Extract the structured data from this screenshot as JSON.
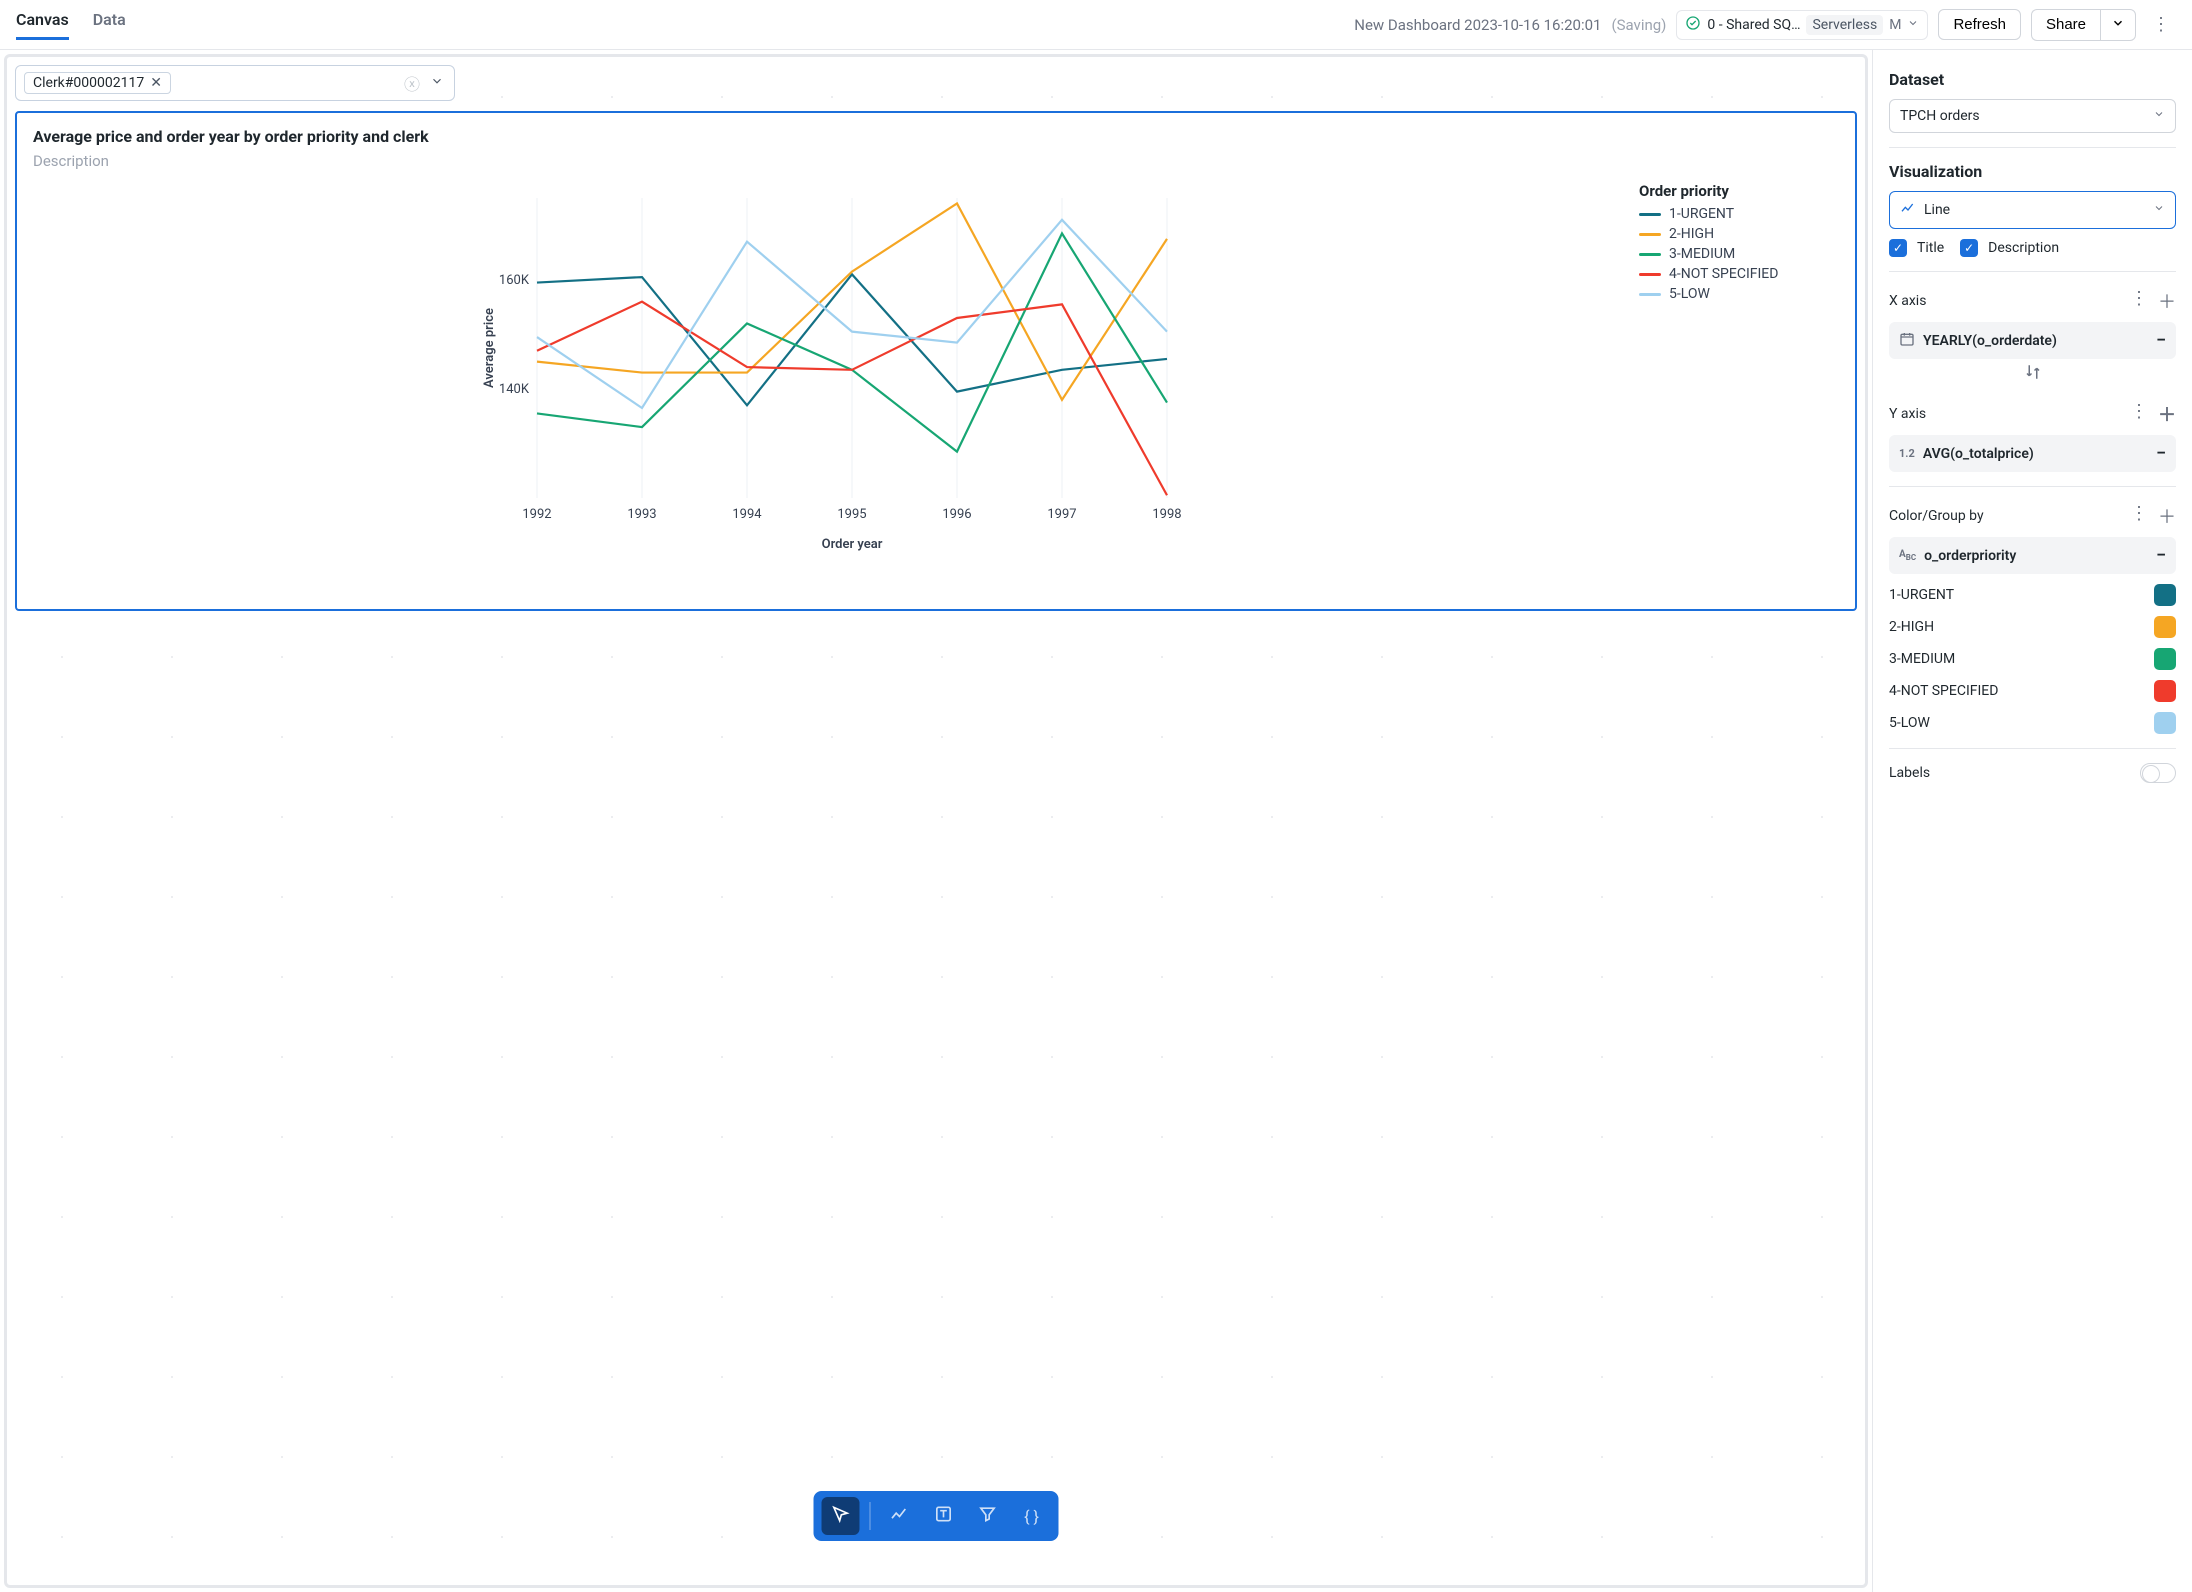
{
  "header": {
    "tabs": [
      {
        "label": "Canvas",
        "active": true
      },
      {
        "label": "Data",
        "active": false
      }
    ],
    "dashboard_title": "New Dashboard 2023-10-16 16:20:01",
    "saving_label": "(Saving)",
    "warehouse": {
      "name": "0 - Shared SQ…",
      "type": "Serverless",
      "size": "M"
    },
    "refresh_label": "Refresh",
    "share_label": "Share"
  },
  "filter": {
    "chip_text": "Clerk#000002117"
  },
  "chart": {
    "title": "Average price and order year by order priority and clerk",
    "description_placeholder": "Description",
    "legend_title": "Order priority",
    "x_axis_title": "Order year",
    "y_axis_title": "Average price"
  },
  "chart_data": {
    "type": "line",
    "x": [
      1992,
      1993,
      1994,
      1995,
      1996,
      1997,
      1998
    ],
    "xlabel": "Order year",
    "ylabel": "Average price",
    "ylim": [
      120000,
      175000
    ],
    "y_ticks": [
      140000,
      160000
    ],
    "y_tick_labels": [
      "140K",
      "160K"
    ],
    "series": [
      {
        "name": "1-URGENT",
        "color": "#137085",
        "values": [
          159500,
          160500,
          137000,
          161000,
          139500,
          143500,
          145500
        ]
      },
      {
        "name": "2-HIGH",
        "color": "#f5a623",
        "values": [
          145000,
          143000,
          143000,
          161500,
          174000,
          138000,
          167500
        ]
      },
      {
        "name": "3-MEDIUM",
        "color": "#17a673",
        "values": [
          135500,
          133000,
          152000,
          143500,
          128500,
          168500,
          137500
        ]
      },
      {
        "name": "4-NOT SPECIFIED",
        "color": "#ef3b2c",
        "values": [
          147000,
          156000,
          144000,
          143500,
          153000,
          155500,
          120500
        ]
      },
      {
        "name": "5-LOW",
        "color": "#9fd0ef",
        "values": [
          149500,
          136500,
          167000,
          150500,
          148500,
          171000,
          150500
        ]
      }
    ]
  },
  "toolbar": {
    "tools": [
      "select",
      "chart",
      "text",
      "filter",
      "code"
    ]
  },
  "side": {
    "dataset_label": "Dataset",
    "dataset_value": "TPCH orders",
    "visualization_label": "Visualization",
    "visualization_value": "Line",
    "title_checkbox_label": "Title",
    "description_checkbox_label": "Description",
    "x_axis_label": "X axis",
    "x_field": "YEARLY(o_orderdate)",
    "y_axis_label": "Y axis",
    "y_field": "AVG(o_totalprice)",
    "group_label": "Color/Group by",
    "group_field": "o_orderpriority",
    "color_series": [
      {
        "name": "1-URGENT",
        "color": "#137085"
      },
      {
        "name": "2-HIGH",
        "color": "#f5a623"
      },
      {
        "name": "3-MEDIUM",
        "color": "#17a673"
      },
      {
        "name": "4-NOT SPECIFIED",
        "color": "#ef3b2c"
      },
      {
        "name": "5-LOW",
        "color": "#9fd0ef"
      }
    ],
    "labels_label": "Labels"
  }
}
